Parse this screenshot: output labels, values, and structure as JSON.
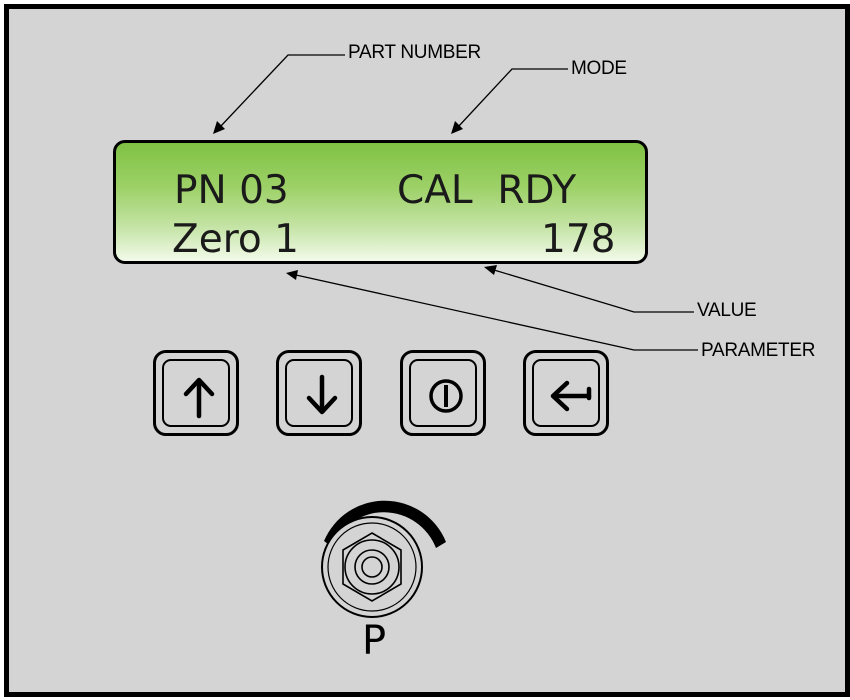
{
  "callouts": {
    "part_number": "PART NUMBER",
    "mode": "MODE",
    "value": "VALUE",
    "parameter": "PARAMETER"
  },
  "lcd": {
    "part_number": "PN 03",
    "mode_text": "CAL  RDY",
    "parameter": "Zero 1",
    "value": "178"
  },
  "buttons": [
    {
      "icon": "arrow-up-icon"
    },
    {
      "icon": "arrow-down-icon"
    },
    {
      "icon": "power-icon"
    },
    {
      "icon": "enter-arrow-icon"
    }
  ],
  "potentiometer": {
    "label": "P"
  },
  "colors": {
    "panel": "#d4d4d4",
    "lcd_top": "#7fc243",
    "lcd_bottom": "#f2faea",
    "outline": "#000000"
  }
}
